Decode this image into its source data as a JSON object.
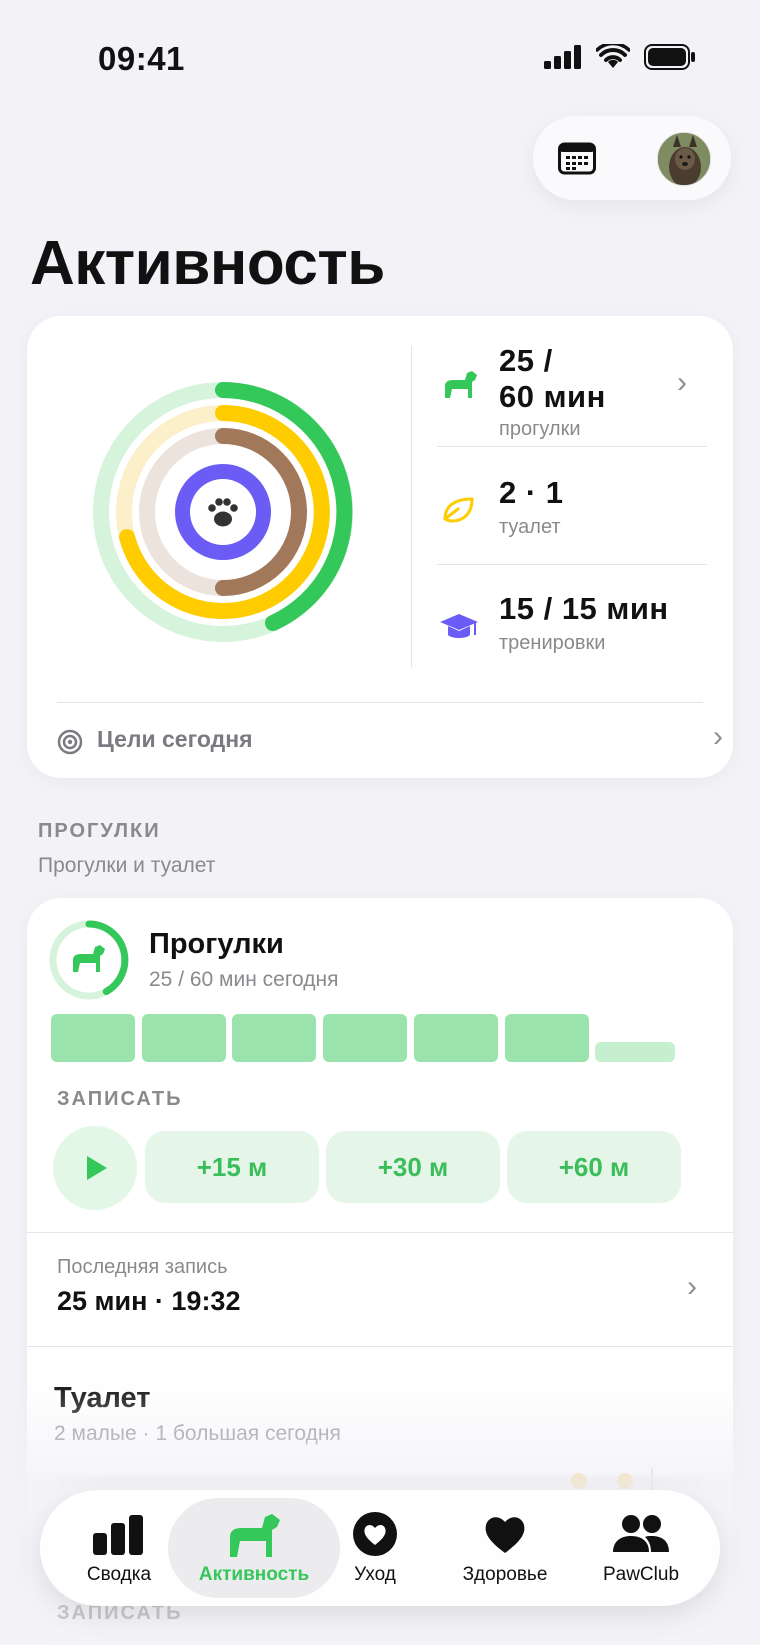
{
  "status_bar": {
    "time": "09:41"
  },
  "header": {
    "title": "Активность"
  },
  "summary": {
    "walks_value": "25 /",
    "walks_value2": "60 мин",
    "walks_label": "прогулки",
    "toilet_value": "2 · 1",
    "toilet_label": "туалет",
    "training_value": "15 / 15 мин",
    "training_label": "тренировки",
    "goals_label": "Цели сегодня",
    "rings": {
      "walks_progress": 0.42,
      "toilet_progress": 0.75,
      "feeding_progress": 0.5,
      "training_progress": 1.0
    }
  },
  "walks_section": {
    "heading": "ПРОГУЛКИ",
    "subheading": "Прогулки и туалет"
  },
  "walks_card": {
    "title": "Прогулки",
    "subtitle": "25 / 60 мин сегодня",
    "progress": 0.42,
    "bars": [
      1,
      1,
      1,
      1,
      1,
      1,
      0.35
    ],
    "record_label": "ЗАПИСАТЬ",
    "quick_add": [
      "+15 м",
      "+30 м",
      "+60 м"
    ],
    "last_label": "Последняя запись",
    "last_value": "25 мин · 19:32"
  },
  "toilet_card": {
    "title": "Туалет",
    "subtitle": "2 малые · 1 большая сегодня",
    "record_label": "ЗАПИСАТЬ"
  },
  "tabbar": {
    "tabs": [
      {
        "label": "Сводка",
        "icon": "chart-bars-icon"
      },
      {
        "label": "Активность",
        "icon": "dog-icon"
      },
      {
        "label": "Уход",
        "icon": "heart-circle-icon"
      },
      {
        "label": "Здоровье",
        "icon": "heart-icon"
      },
      {
        "label": "PawClub",
        "icon": "people-icon"
      }
    ],
    "active": "Активность"
  },
  "colors": {
    "green": "#34c759",
    "yellow": "#ffcc00",
    "brown": "#a2785a",
    "purple": "#6a5cf5",
    "light_green": "#9be3ac"
  }
}
